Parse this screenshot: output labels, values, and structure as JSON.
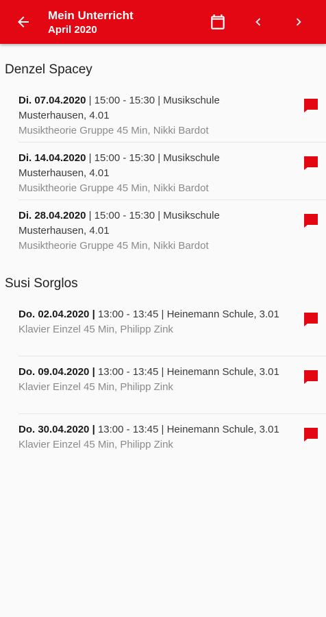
{
  "header": {
    "title": "Mein Unterricht",
    "subtitle": "April 2020",
    "back_icon": "arrow-left-icon",
    "calendar_icon": "calendar-icon",
    "prev_icon": "chevron-left-icon",
    "next_icon": "chevron-right-icon",
    "background_color": "#e30613"
  },
  "groups": [
    {
      "student": "Denzel Spacey",
      "lessons": [
        {
          "date": "Di. 07.04.2020",
          "details": " | 15:00 - 15:30 | Musikschule Musterhausen, 4.01",
          "course": "Musiktheorie Gruppe 45 Min, Nikki Bardot"
        },
        {
          "date": "Di. 14.04.2020",
          "details": " | 15:00 - 15:30 | Musikschule Musterhausen, 4.01",
          "course": "Musiktheorie Gruppe 45 Min, Nikki Bardot"
        },
        {
          "date": "Di. 28.04.2020",
          "details": " | 15:00 - 15:30 | Musikschule Musterhausen, 4.01",
          "course": "Musiktheorie Gruppe 45 Min, Nikki Bardot"
        }
      ]
    },
    {
      "student": "Susi Sorglos",
      "lessons": [
        {
          "date": "Do. 02.04.2020 |",
          "details": " 13:00 - 13:45 | Heinemann Schule, 3.01",
          "course": "Klavier Einzel 45 Min, Philipp Zink"
        },
        {
          "date": "Do. 09.04.2020 |",
          "details": " 13:00 - 13:45 | Heinemann Schule, 3.01",
          "course": "Klavier Einzel 45 Min, Philipp Zink"
        },
        {
          "date": "Do. 30.04.2020 |",
          "details": " 13:00 - 13:45 | Heinemann Schule, 3.01",
          "course": "Klavier Einzel 45 Min, Philipp Zink"
        }
      ]
    }
  ],
  "lesson_icon": "message-flag-icon",
  "accent_color": "#e30613"
}
